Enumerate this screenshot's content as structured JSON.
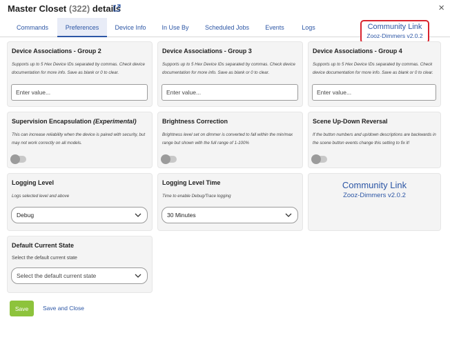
{
  "header": {
    "title": "Master Closet",
    "count": "(322)",
    "suffix": "details",
    "close": "×"
  },
  "tabs": [
    {
      "label": "Commands"
    },
    {
      "label": "Preferences"
    },
    {
      "label": "Device Info"
    },
    {
      "label": "In Use By"
    },
    {
      "label": "Scheduled Jobs"
    },
    {
      "label": "Events"
    },
    {
      "label": "Logs"
    }
  ],
  "active_tab": "Preferences",
  "community_link": {
    "title": "Community Link",
    "subtitle": "Zooz-Dimmers v2.0.2"
  },
  "cards": {
    "assoc2": {
      "title": "Device Associations - Group 2",
      "desc": "Supports up to 5 Hex Device IDs separated by commas. Check device documentation for more info. Save as blank or 0 to clear.",
      "placeholder": "Enter value..."
    },
    "assoc3": {
      "title": "Device Associations - Group 3",
      "desc": "Supports up to 5 Hex Device IDs separated by commas. Check device documentation for more info. Save as blank or 0 to clear.",
      "placeholder": "Enter value..."
    },
    "assoc4": {
      "title": "Device Associations - Group 4",
      "desc": "Supports up to 5 Hex Device IDs separated by commas. Check device documentation for more info. Save as blank or 0 to clear.",
      "placeholder": "Enter value..."
    },
    "supervision": {
      "title": "Supervision Encapsulation",
      "title_em": "(Experimental)",
      "desc": "This can increase reliability when the device is paired with security, but may not work correctly on all models.",
      "enabled": false
    },
    "brightness": {
      "title": "Brightness Correction",
      "desc": "Brightness level set on dimmer is converted to fall within the min/max range but shown with the full range of 1-100%",
      "enabled": false
    },
    "scene_reversal": {
      "title": "Scene Up-Down Reversal",
      "desc": "If the button numbers and up/down descriptions are backwards in the scene button events change this setting to fix it!",
      "enabled": false
    },
    "logging_level": {
      "title": "Logging Level",
      "desc": "Logs selected level and above",
      "value": "Debug"
    },
    "logging_time": {
      "title": "Logging Level Time",
      "desc": "Time to enable Debug/Trace logging",
      "value": "30 Minutes"
    },
    "community_card": {
      "title": "Community Link",
      "subtitle": "Zooz-Dimmers v2.0.2"
    },
    "default_state": {
      "title": "Default Current State",
      "desc": "Select the default current state",
      "value": "Select the default current state"
    }
  },
  "footer": {
    "save": "Save",
    "save_close": "Save and Close"
  },
  "colors": {
    "link_blue": "#2c56a5",
    "save_green": "#8dc33c",
    "highlight_red": "#d9232d"
  }
}
